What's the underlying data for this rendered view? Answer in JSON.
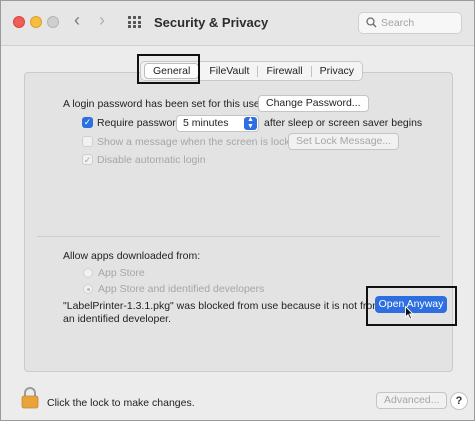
{
  "window": {
    "title": "Security & Privacy",
    "search_placeholder": "Search",
    "nav_back": "‹",
    "nav_forward": "›"
  },
  "tabs": [
    "General",
    "FileVault",
    "Firewall",
    "Privacy"
  ],
  "selected_tab": "General",
  "general": {
    "login_password_text": "A login password has been set for this user",
    "change_password_label": "Change Password...",
    "require_password_label": "Require password",
    "require_password_checked": true,
    "require_password_delay": "5 minutes",
    "require_password_suffix": "after sleep or screen saver begins",
    "show_message_label": "Show a message when the screen is locked",
    "show_message_checked": false,
    "set_lock_message_label": "Set Lock Message...",
    "disable_auto_login_label": "Disable automatic login",
    "disable_auto_login_checked": true
  },
  "downloads": {
    "heading": "Allow apps downloaded from:",
    "options": [
      "App Store",
      "App Store and identified developers"
    ],
    "selected_option": "App Store and identified developers",
    "blocked_line1": "\"LabelPrinter-1.3.1.pkg\" was blocked from use because it is not from",
    "blocked_line2": "an identified developer.",
    "open_anyway_label": "Open Anyway"
  },
  "footer": {
    "lock_text": "Click the lock to make changes.",
    "advanced_label": "Advanced...",
    "help_label": "?"
  },
  "colors": {
    "accent": "#2d6fe0",
    "close": "#ee5f57",
    "minimize": "#f5be40",
    "lock": "#e8a33d"
  }
}
